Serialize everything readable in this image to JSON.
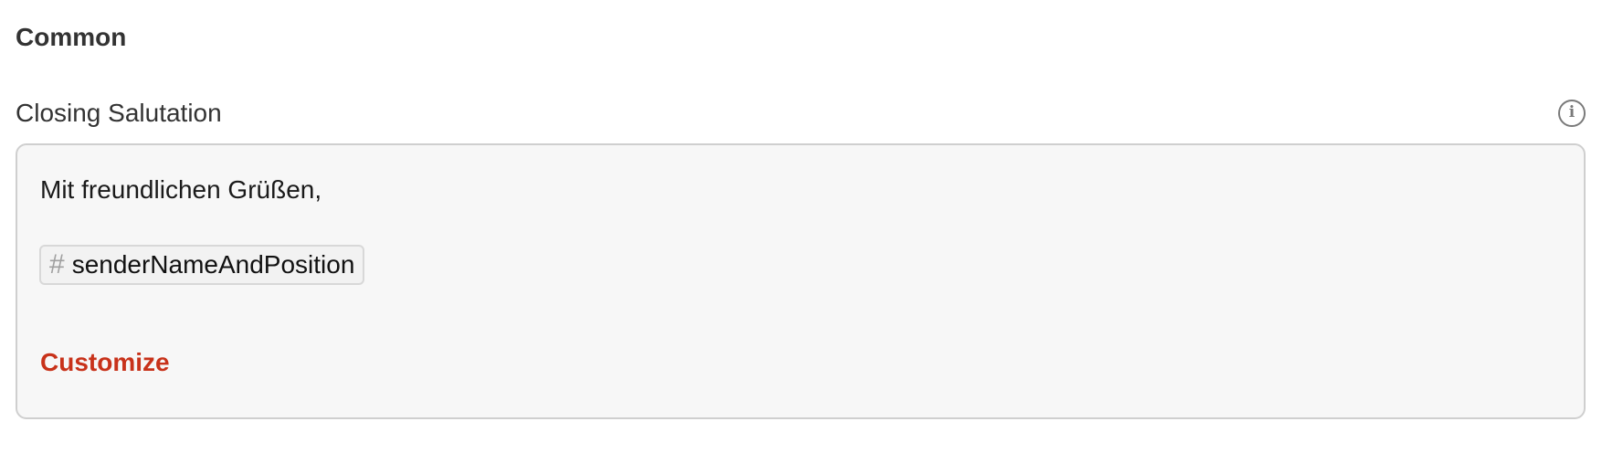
{
  "section": {
    "title": "Common"
  },
  "closing_salutation": {
    "label": "Closing Salutation",
    "info_icon": "info-icon",
    "greeting_text": "Mit freundlichen Grüßen,",
    "placeholder_icon": "hash-icon",
    "placeholder_symbol": "#",
    "placeholder_label": "senderNameAndPosition",
    "customize_label": "Customize"
  },
  "colors": {
    "accent_link": "#c8321a",
    "field_background": "#f7f7f7",
    "field_border": "#cfcfcf"
  }
}
